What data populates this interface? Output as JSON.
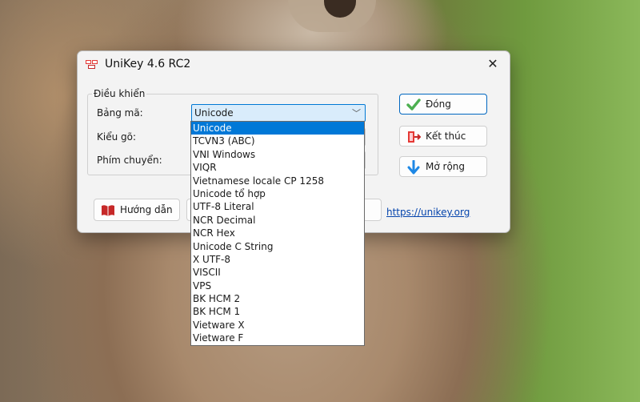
{
  "window": {
    "title": "UniKey 4.6 RC2",
    "icon": "unikey-keyboard-icon",
    "close_icon": "close-icon"
  },
  "group": {
    "label": "Điều khiển"
  },
  "fields": {
    "charset_label": "Bảng mã:",
    "charset_value": "Unicode",
    "input_method_label": "Kiểu gõ:",
    "switch_key_label": "Phím chuyển:"
  },
  "buttons": {
    "close": {
      "label": "Đóng",
      "icon": "checkmark-icon"
    },
    "exit": {
      "label": "Kết thúc",
      "icon": "exit-door-icon"
    },
    "expand": {
      "label": "Mở rộng",
      "icon": "arrow-down-icon"
    },
    "help": {
      "label": "Hướng dẫn",
      "icon": "book-icon"
    }
  },
  "link": {
    "text": "https://unikey.org"
  },
  "dropdown": {
    "selected": "Unicode",
    "options": [
      "Unicode",
      "TCVN3 (ABC)",
      "VNI Windows",
      "VIQR",
      "Vietnamese locale CP 1258",
      "Unicode tổ hợp",
      "UTF-8 Literal",
      "NCR Decimal",
      "NCR Hex",
      "Unicode C String",
      "X UTF-8",
      "VISCII",
      "VPS",
      "BK HCM 2",
      "BK HCM 1",
      "Vietware X",
      "Vietware F"
    ]
  },
  "colors": {
    "accent": "#0078d7",
    "selection_bg": "#d9ecfb",
    "link": "#0645ad"
  }
}
